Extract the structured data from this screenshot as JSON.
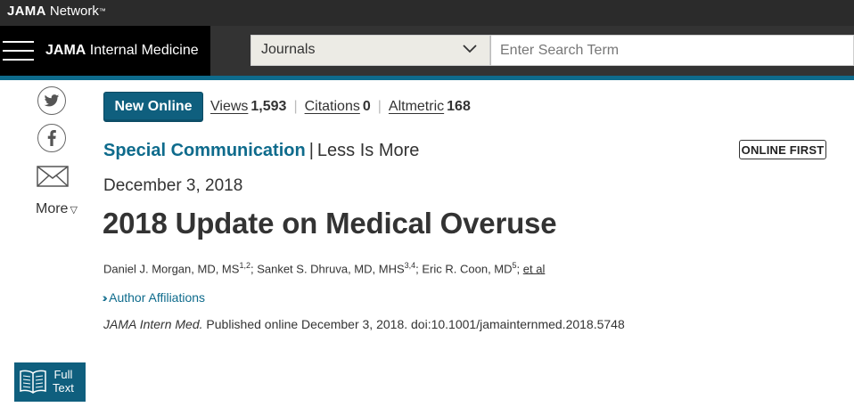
{
  "network": {
    "brand_bold": "JAMA",
    "brand_rest": " Network",
    "tm": "™"
  },
  "journal": {
    "name_bold": "JAMA",
    "name_rest": " Internal Medicine"
  },
  "search": {
    "journals_select": "Journals",
    "placeholder": "Enter Search Term"
  },
  "share": {
    "more_label": "More",
    "more_glyph": "▽"
  },
  "metrics": {
    "new_online": "New Online",
    "views_label": "Views",
    "views_value": "1,593",
    "citations_label": "Citations",
    "citations_value": "0",
    "altmetric_label": "Altmetric",
    "altmetric_value": "168"
  },
  "article": {
    "type": "Special Communication",
    "series": "Less Is More",
    "badge": "ONLINE FIRST",
    "date": "December 3, 2018",
    "title": "2018 Update on Medical Overuse",
    "authors": [
      {
        "name": "Daniel J. Morgan, MD, MS",
        "affil": "1,2"
      },
      {
        "name": "Sanket S. Dhruva, MD, MHS",
        "affil": "3,4"
      },
      {
        "name": "Eric R. Coon, MD",
        "affil": "5"
      }
    ],
    "et_al": "et al",
    "affiliations_label": "Author Affiliations",
    "citation_journal": "JAMA Intern Med.",
    "citation_rest": " Published online December 3, 2018. doi:10.1001/jamainternmed.2018.5748"
  },
  "full_text": {
    "line1": "Full",
    "line2": "Text"
  },
  "colors": {
    "accent": "#0e6b8c",
    "button": "#0f5f7e",
    "header_dark": "#333333",
    "network_bar": "#2b2b2b"
  }
}
